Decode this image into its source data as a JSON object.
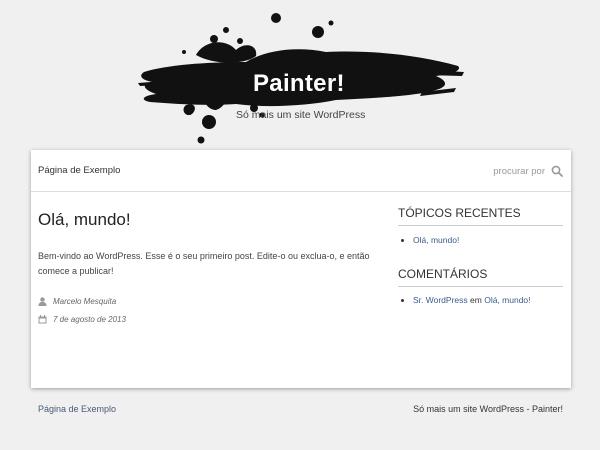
{
  "site": {
    "title": "Painter!",
    "tagline": "Só mais um site WordPress"
  },
  "nav": {
    "page_link": "Página de Exemplo",
    "search_placeholder": "procurar por",
    "search_icon": "search-icon"
  },
  "post": {
    "title": "Olá, mundo!",
    "body": "Bem-vindo ao WordPress. Esse é o seu primeiro post. Edite-o ou exclua-o, e então comece a publicar!",
    "author": "Marcelo Mesquita",
    "date": "7 de agosto de 2013"
  },
  "sidebar": {
    "recent_title": "TÓPICOS RECENTES",
    "recent_items": [
      "Olá, mundo!"
    ],
    "comments_title": "COMENTÁRIOS",
    "comment": {
      "author": "Sr. WordPress",
      "connector": "em",
      "post": "Olá, mundo!"
    }
  },
  "footer": {
    "left_link": "Página de Exemplo",
    "credit": "Só mais um site WordPress - Painter!"
  },
  "colors": {
    "background": "#f0f0f0",
    "link": "#3b5b8f",
    "splash": "#111111"
  }
}
